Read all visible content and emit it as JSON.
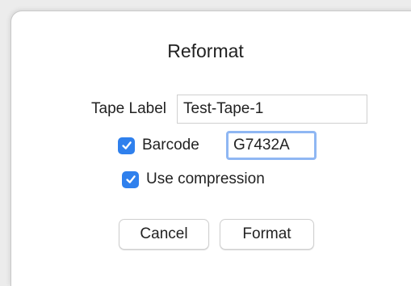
{
  "dialog": {
    "title": "Reformat",
    "tape_label": {
      "label": "Tape Label",
      "value": "Test-Tape-1"
    },
    "barcode": {
      "label": "Barcode",
      "checked": true,
      "value": "G7432A"
    },
    "compression": {
      "label": "Use compression",
      "checked": true
    },
    "buttons": {
      "cancel": "Cancel",
      "format": "Format"
    }
  },
  "colors": {
    "accent": "#2f80ed",
    "focus_ring": "#8fb7f3"
  }
}
